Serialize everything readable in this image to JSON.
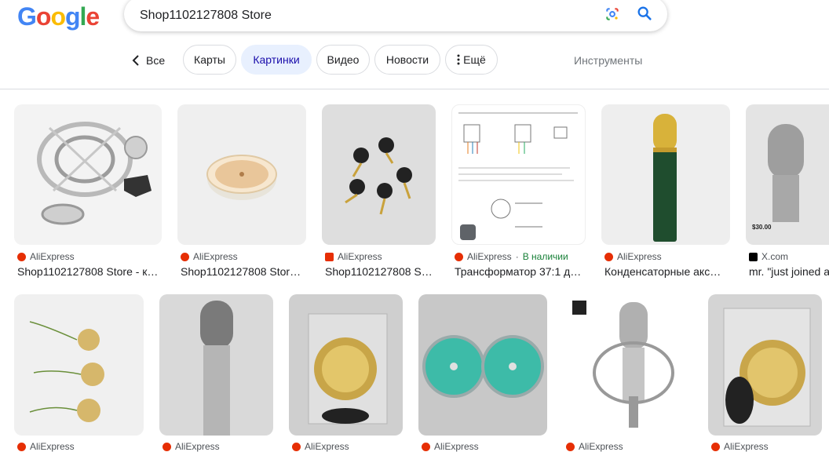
{
  "search": {
    "query": "Shop1102127808 Store"
  },
  "logo": {
    "letters": [
      "G",
      "o",
      "o",
      "g",
      "l",
      "e"
    ],
    "colors": [
      "#4285f4",
      "#ea4335",
      "#fbbc05",
      "#4285f4",
      "#34a853",
      "#ea4335"
    ]
  },
  "tabs": {
    "back_label": "Все",
    "items": [
      "Карты",
      "Картинки",
      "Видео",
      "Новости",
      "Ещё"
    ],
    "active": "Картинки",
    "tools_label": "Инструменты"
  },
  "colors": {
    "accent": "#1a73e8",
    "chip_active_bg": "#e8f0fe",
    "aliexpress": "#e62e04",
    "in_stock": "#188038"
  },
  "row1": [
    {
      "source": "AliExpress",
      "title": "Shop1102127808 Store - к…",
      "icon": "aliexpress-icon"
    },
    {
      "source": "AliExpress",
      "title": "Shop1102127808 Stor…",
      "icon": "aliexpress-icon"
    },
    {
      "source": "AliExpress",
      "title": "Shop1102127808 S…",
      "icon": "aliexpress-icon"
    },
    {
      "source": "AliExpress",
      "stock": "В наличии",
      "title": "Трансформатор 37:1 д…",
      "icon": "aliexpress-icon"
    },
    {
      "source": "AliExpress",
      "title": "Конденсаторные акс…",
      "icon": "aliexpress-icon"
    },
    {
      "source": "X.com",
      "title": "mr. \"just joined a",
      "icon": "x-icon",
      "overlay_price": "$30.00"
    }
  ],
  "row2": [
    {
      "source": "AliExpress"
    },
    {
      "source": "AliExpress"
    },
    {
      "source": "AliExpress"
    },
    {
      "source": "AliExpress"
    },
    {
      "source": "AliExpress"
    },
    {
      "source": "AliExpress"
    }
  ]
}
